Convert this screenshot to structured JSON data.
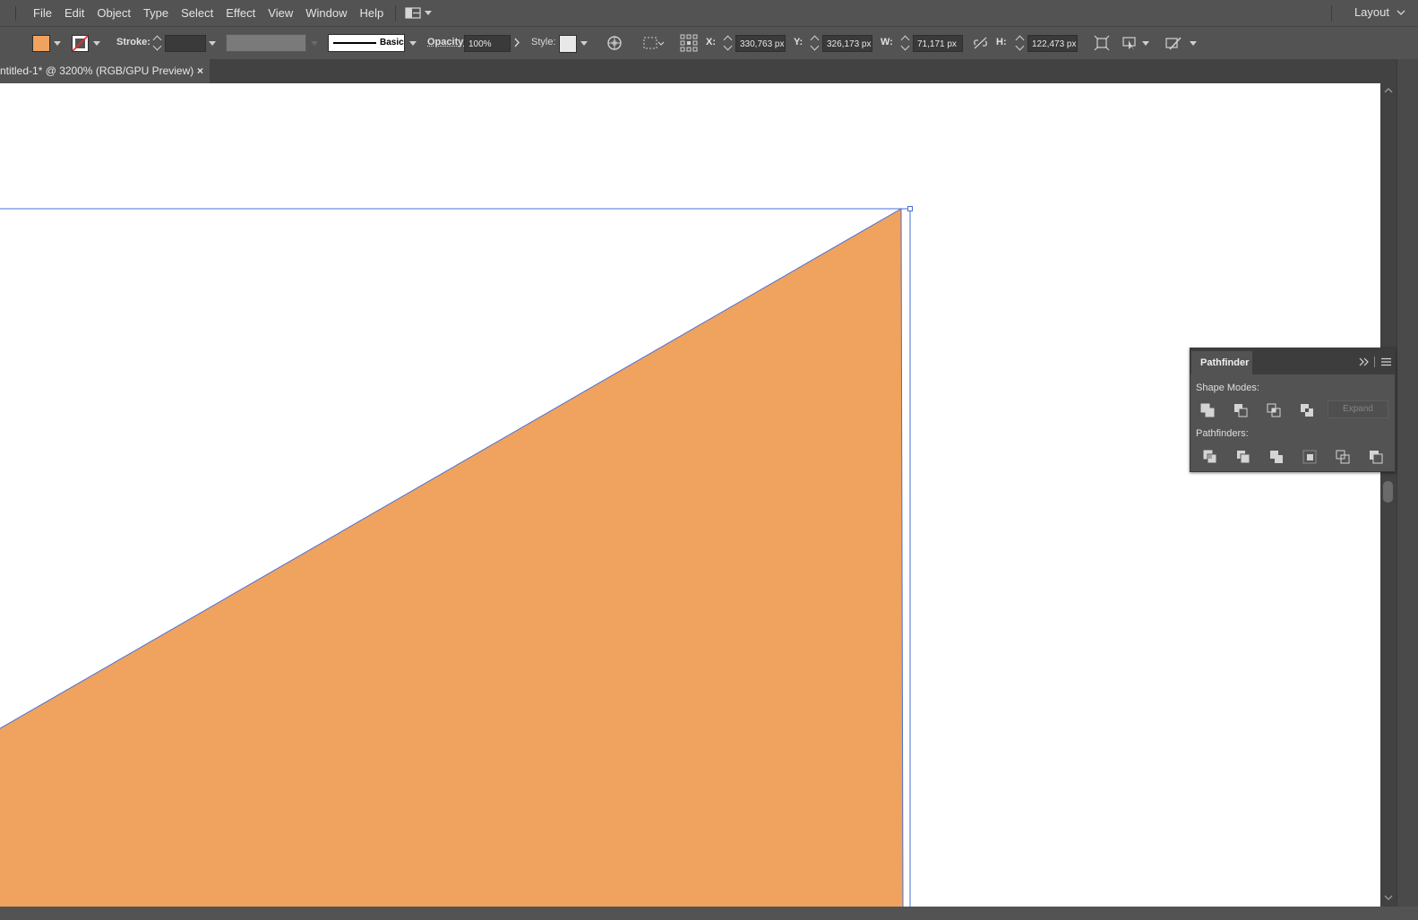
{
  "menubar": {
    "items": [
      "File",
      "Edit",
      "Object",
      "Type",
      "Select",
      "Effect",
      "View",
      "Window",
      "Help"
    ],
    "workspace_label": "Layout"
  },
  "controlbar": {
    "fill_color": "#f0a35e",
    "stroke_label": "Stroke:",
    "stroke_weight": "",
    "brush_definition": "Basic",
    "opacity_label": "Opacity:",
    "opacity_value": "100%",
    "style_label": "Style:",
    "x_label": "X:",
    "x_value": "330,763 px",
    "y_label": "Y:",
    "y_value": "326,173 px",
    "w_label": "W:",
    "w_value": "71,171 px",
    "h_label": "H:",
    "h_value": "122,473 px"
  },
  "document": {
    "tab_title": "ntitled-1* @ 3200% (RGB/GPU Preview)",
    "close_glyph": "×"
  },
  "artwork": {
    "shape": "triangle",
    "fill_color": "#f0a35e",
    "selection_color": "#4a6fd6",
    "canvas_color": "#ffffff"
  },
  "pathfinder": {
    "title": "Pathfinder",
    "shape_modes_label": "Shape Modes:",
    "pathfinders_label": "Pathfinders:",
    "expand_label": "Expand",
    "shape_mode_icons": [
      "unite-icon",
      "minus-front-icon",
      "intersect-icon",
      "exclude-icon"
    ],
    "pathfinder_icons": [
      "divide-icon",
      "trim-icon",
      "merge-icon",
      "crop-icon",
      "outline-icon",
      "minus-back-icon"
    ]
  }
}
